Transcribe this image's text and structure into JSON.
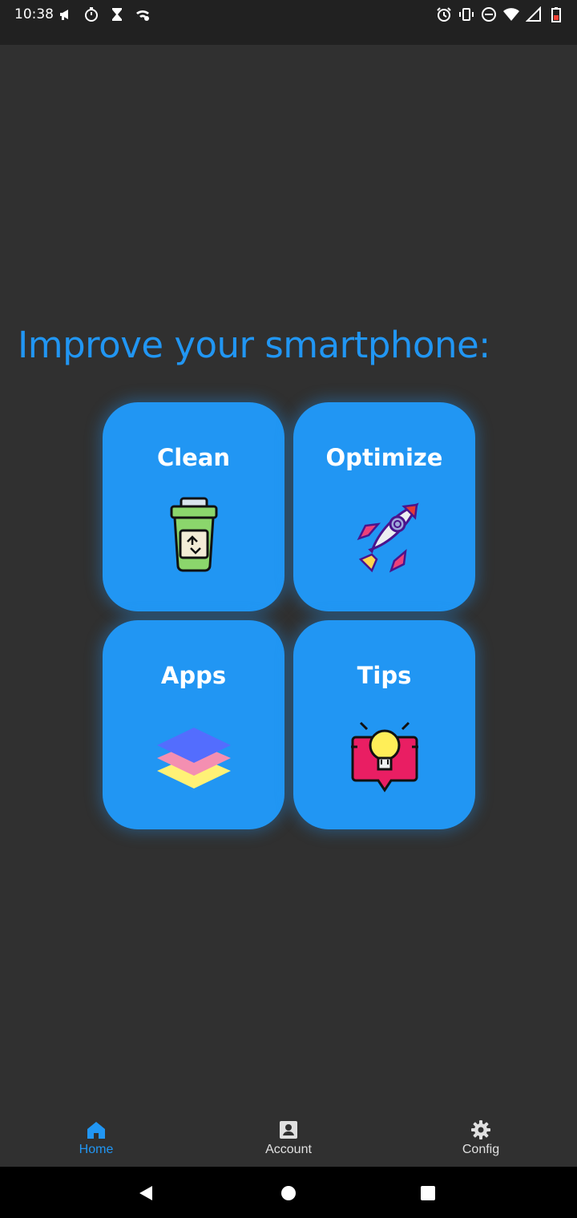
{
  "status_bar": {
    "time": "10:38",
    "left_icons": [
      "megaphone-icon",
      "timer-icon",
      "hourglass-icon",
      "wifi-calling-icon"
    ],
    "right_icons": [
      "alarm-icon",
      "vibrate-icon",
      "dnd-icon",
      "wifi-icon",
      "signal-icon",
      "battery-icon"
    ]
  },
  "main": {
    "heading": "Improve your smartphone:",
    "tiles": [
      {
        "label": "Clean",
        "icon": "recycle-bin-icon"
      },
      {
        "label": "Optimize",
        "icon": "rocket-icon"
      },
      {
        "label": "Apps",
        "icon": "layers-icon"
      },
      {
        "label": "Tips",
        "icon": "lightbulb-icon"
      }
    ]
  },
  "bottom_nav": {
    "items": [
      {
        "label": "Home",
        "icon": "home-icon",
        "active": true
      },
      {
        "label": "Account",
        "icon": "account-icon",
        "active": false
      },
      {
        "label": "Config",
        "icon": "gear-icon",
        "active": false
      }
    ]
  },
  "system_nav": {
    "buttons": [
      "back-icon",
      "home-circle-icon",
      "recent-apps-icon"
    ]
  },
  "colors": {
    "accent": "#2196f3",
    "background": "#303030",
    "status_bar": "#212121",
    "system_nav": "#000000"
  }
}
